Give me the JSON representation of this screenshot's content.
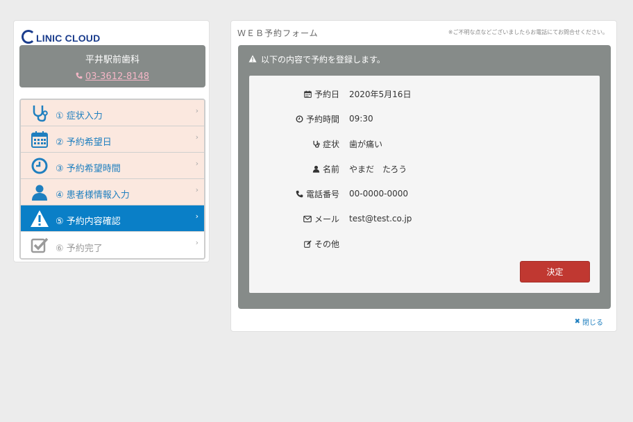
{
  "brand": {
    "logo_text": "LINIC CLOUD"
  },
  "clinic": {
    "name": "平井駅前歯科",
    "phone": "03-3612-8148"
  },
  "steps": [
    {
      "label": "① 症状入力",
      "icon": "stethoscope-icon"
    },
    {
      "label": "② 予約希望日",
      "icon": "calendar-icon"
    },
    {
      "label": "③ 予約希望時間",
      "icon": "clock-icon"
    },
    {
      "label": "④ 患者様情報入力",
      "icon": "user-icon"
    },
    {
      "label": "⑤ 予約内容確認",
      "icon": "warning-icon",
      "active": true
    },
    {
      "label": "⑥ 予約完了",
      "icon": "checkbox-icon"
    }
  ],
  "form": {
    "title": "ＷＥＢ予約フォーム",
    "note": "※ご不明な点などございましたらお電話にてお問合せください。",
    "confirm_message": "以下の内容で予約を登録します。",
    "fields": [
      {
        "label": "予約日",
        "value": "2020年5月16日",
        "icon": "calendar-icon"
      },
      {
        "label": "予約時間",
        "value": "09:30",
        "icon": "clock-icon"
      },
      {
        "label": "症状",
        "value": "歯が痛い",
        "icon": "stethoscope-icon"
      },
      {
        "label": "名前",
        "value": "やまだ　たろう",
        "icon": "user-icon"
      },
      {
        "label": "電話番号",
        "value": "00-0000-0000",
        "icon": "phone-icon"
      },
      {
        "label": "メール",
        "value": "test@test.co.jp",
        "icon": "envelope-icon"
      },
      {
        "label": "その他",
        "value": "",
        "icon": "edit-icon"
      }
    ],
    "submit_label": "決定",
    "close_label": "閉じる"
  },
  "colors": {
    "accent": "#0a7fc7",
    "submit": "#c03831",
    "panel_gray": "#868b89",
    "step_bg": "#fbe8df"
  }
}
